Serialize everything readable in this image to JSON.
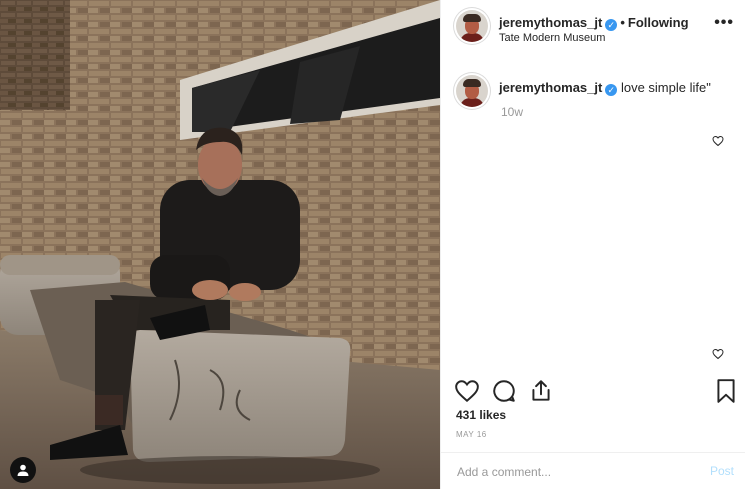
{
  "header": {
    "username": "jeremythomas_jt",
    "verified_mark": "✓",
    "separator": "•",
    "follow_status": "Following",
    "location": "Tate Modern Museum",
    "more_icon": "more-horizontal-icon",
    "more_label": "•••"
  },
  "caption": {
    "username": "jeremythomas_jt",
    "verified_mark": "✓",
    "text": "love simple life\"",
    "time": "10w"
  },
  "post": {
    "likes": "431 likes",
    "date": "MAY 16"
  },
  "actions": {
    "like_icon": "heart-icon",
    "comment_icon": "comment-icon",
    "share_icon": "share-icon",
    "save_icon": "bookmark-icon"
  },
  "comment_box": {
    "placeholder": "Add a comment...",
    "post_label": "Post"
  },
  "colors": {
    "verified": "#3897f0",
    "post_disabled": "#b2dffc",
    "muted": "#999999",
    "text": "#262626"
  }
}
